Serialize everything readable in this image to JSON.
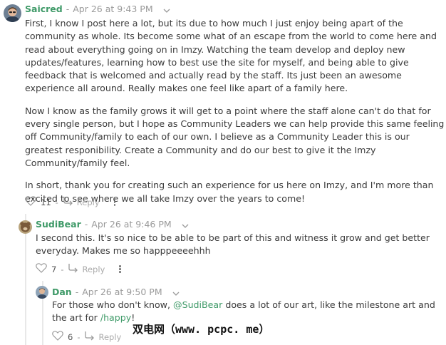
{
  "comments": [
    {
      "author": "Saicred",
      "timestamp": "Apr 26 at 9:43 PM",
      "paragraphs": [
        "First, I know I post here a lot, but its due to how much I just enjoy being apart of the community as whole. Its become some what of an escape from the world to come here and read about everything going on in Imzy. Watching the team develop and deploy new updates/features, learning how to best use the site for myself, and being able to give feedback that is welcomed and actually read by the staff. Its just been an awesome experience all around. Really makes one feel like apart of a family here.",
        "Now I know as the family grows it will get to a point where the staff alone can't do that for every single person, but I hope as Community Leaders we can help provide this same feeling off Community/family to each of our own. I believe as a Community Leader this is our greatest responibility. Create a Community and do our best to give it the Imzy Community/family feel.",
        "In short, thank you for creating such an experience for us here on Imzy, and I'm more than excited to see where we all take Imzy over the years to come!"
      ],
      "likes": "11",
      "reply_label": "Reply"
    },
    {
      "author": "SudiBear",
      "timestamp": "Apr 26 at 9:46 PM",
      "paragraphs": [
        "I second this. It's so nice to be able to be part of this and witness it grow and get better everyday. Makes me so happpeeeehhh"
      ],
      "likes": "7",
      "reply_label": "Reply"
    },
    {
      "author": "Dan",
      "timestamp": "Apr 26 at 9:50 PM",
      "body_parts": [
        "For those who don't know, ",
        "@SudiBear",
        " does a lot of our art, like the milestone art and the art for ",
        "/happy",
        "!"
      ],
      "likes": "6",
      "reply_label": "Reply"
    }
  ],
  "separator": "-",
  "watermark": "双电网（www. pcpc. me）",
  "colors": {
    "author": "#3f9a68",
    "muted": "#9a9a9a",
    "text": "#3a3a3a"
  },
  "icons": [
    "avatar",
    "chevron-down-icon",
    "heart-icon",
    "reply-arrow-icon",
    "more-options-icon"
  ]
}
